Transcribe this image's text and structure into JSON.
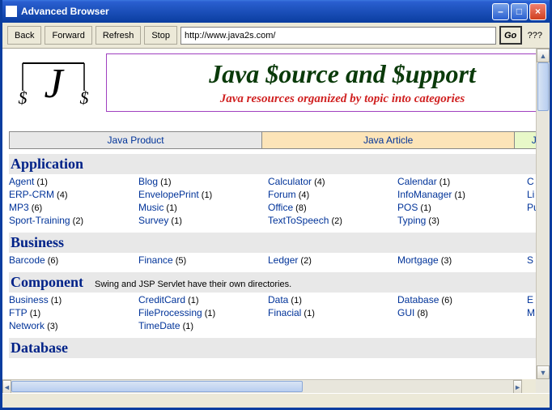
{
  "window": {
    "title": "Advanced Browser"
  },
  "toolbar": {
    "back": "Back",
    "forward": "Forward",
    "refresh": "Refresh",
    "stop": "Stop",
    "url": "http://www.java2s.com/",
    "go": "Go",
    "status": "???"
  },
  "banner": {
    "title": "Java $ource and $upport",
    "subtitle": "Java resources organized by topic into categories"
  },
  "tabs": [
    "Java Product",
    "Java Article",
    "Java B"
  ],
  "sections": [
    {
      "title": "Application",
      "note": "",
      "rows": [
        [
          {
            "t": "Agent",
            "c": 1
          },
          {
            "t": "Blog",
            "c": 1
          },
          {
            "t": "Calculator",
            "c": 4
          },
          {
            "t": "Calendar",
            "c": 1
          },
          {
            "t": "C"
          }
        ],
        [
          {
            "t": "ERP-CRM",
            "c": 4
          },
          {
            "t": "EnvelopePrint",
            "c": 1
          },
          {
            "t": "Forum",
            "c": 4
          },
          {
            "t": "InfoManager",
            "c": 1
          },
          {
            "t": "Li"
          }
        ],
        [
          {
            "t": "MP3",
            "c": 6
          },
          {
            "t": "Music",
            "c": 1
          },
          {
            "t": "Office",
            "c": 8
          },
          {
            "t": "POS",
            "c": 1
          },
          {
            "t": "Pu"
          }
        ],
        [
          {
            "t": "Sport-Training",
            "c": 2
          },
          {
            "t": "Survey",
            "c": 1
          },
          {
            "t": "TextToSpeech",
            "c": 2
          },
          {
            "t": "Typing",
            "c": 3
          },
          {
            "t": ""
          }
        ]
      ]
    },
    {
      "title": "Business",
      "note": "",
      "rows": [
        [
          {
            "t": "Barcode",
            "c": 6
          },
          {
            "t": "Finance",
            "c": 5
          },
          {
            "t": "Ledger",
            "c": 2
          },
          {
            "t": "Mortgage",
            "c": 3
          },
          {
            "t": "S"
          }
        ]
      ]
    },
    {
      "title": "Component",
      "note": "Swing and JSP Servlet have their own directories.",
      "rows": [
        [
          {
            "t": "Business",
            "c": 1
          },
          {
            "t": "CreditCard",
            "c": 1
          },
          {
            "t": "Data",
            "c": 1
          },
          {
            "t": "Database",
            "c": 6
          },
          {
            "t": "E"
          }
        ],
        [
          {
            "t": "FTP",
            "c": 1
          },
          {
            "t": "FileProcessing",
            "c": 1
          },
          {
            "t": "Finacial",
            "c": 1
          },
          {
            "t": "GUI",
            "c": 8
          },
          {
            "t": "M"
          }
        ],
        [
          {
            "t": "Network",
            "c": 3
          },
          {
            "t": "TimeDate",
            "c": 1
          },
          {
            "t": ""
          },
          {
            "t": ""
          },
          {
            "t": ""
          }
        ]
      ]
    },
    {
      "title": "Database",
      "note": "",
      "rows": []
    }
  ]
}
